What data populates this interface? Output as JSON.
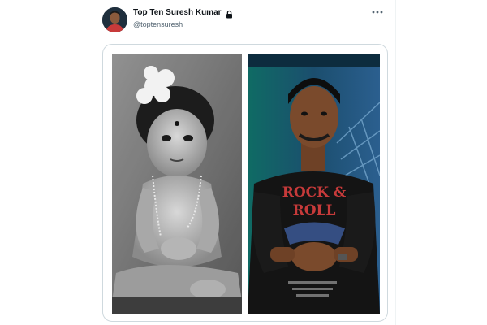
{
  "post": {
    "author_name": "Top Ten Suresh Kumar",
    "author_handle": "@toptensuresh"
  },
  "icons": {
    "verified_lock": "lock-icon",
    "more_menu": "more-horizontal-icon"
  },
  "media": {
    "left_photo": "childhood-portrait",
    "right_photo": "adult-portrait",
    "shirt_print_line1": "ROCK &",
    "shirt_print_line2": "ROLL"
  },
  "colors": {
    "text_primary": "#0f1419",
    "text_secondary": "#536471",
    "border": "#cfd9de",
    "shirt_print": "#c63a3a"
  }
}
